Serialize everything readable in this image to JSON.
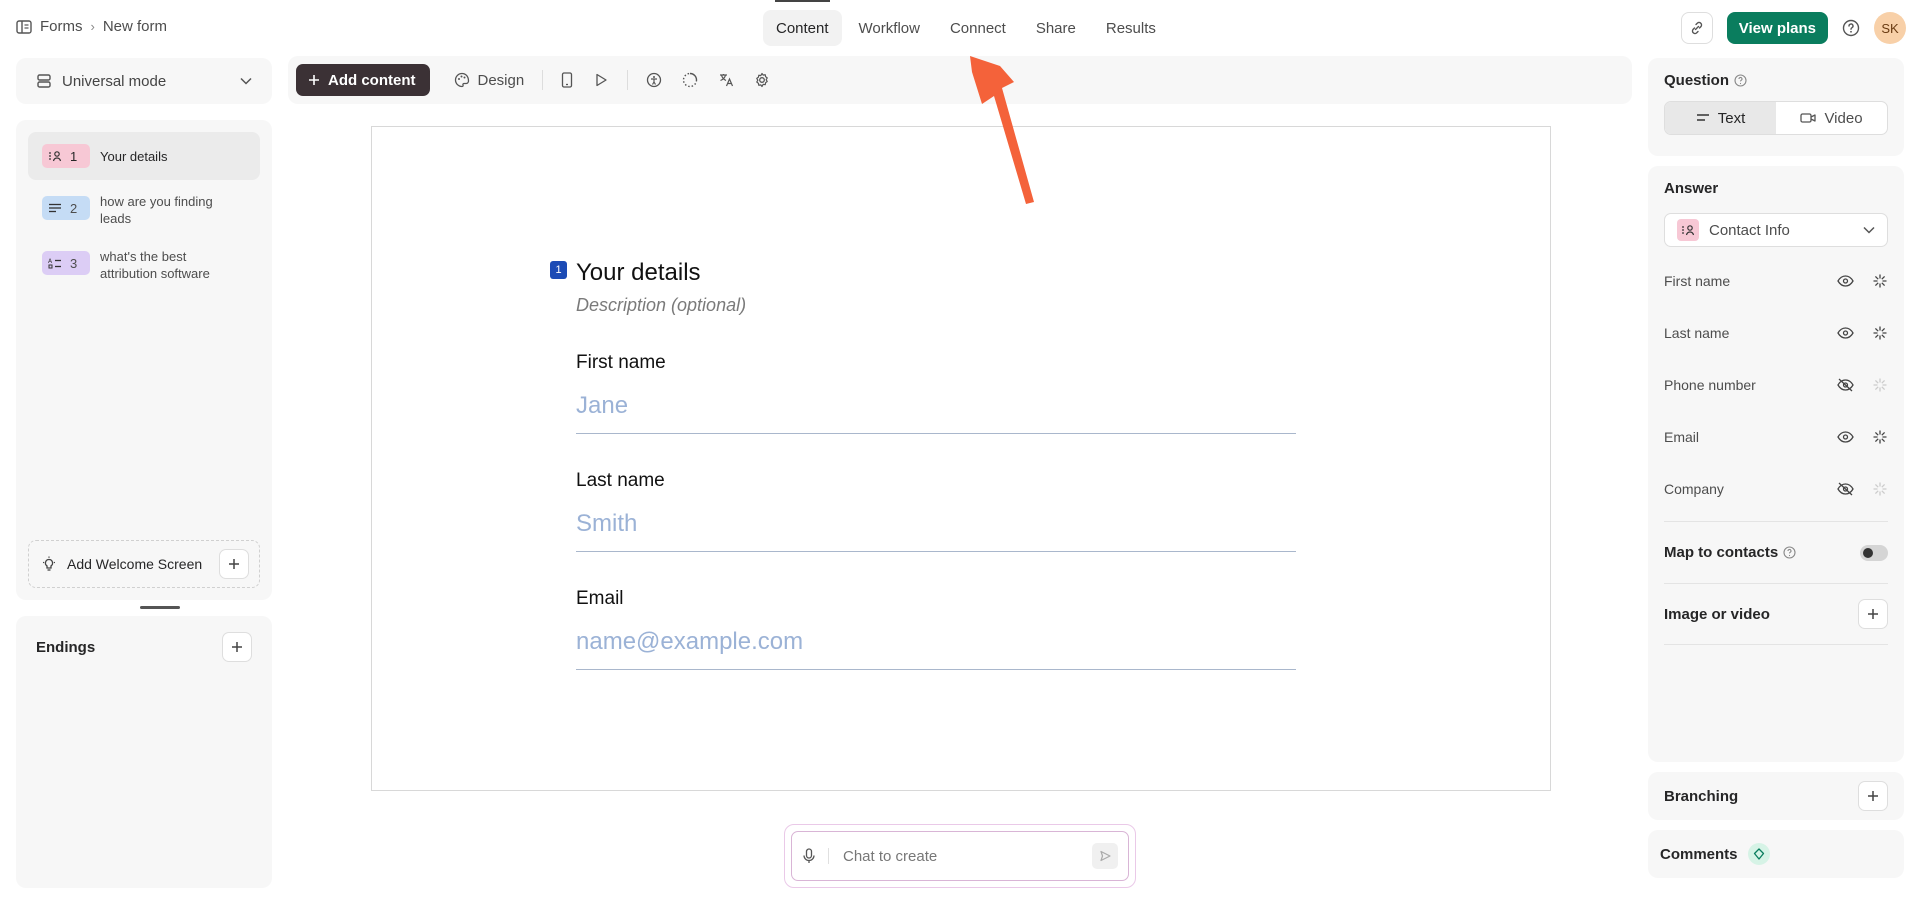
{
  "breadcrumb": {
    "root": "Forms",
    "current": "New form"
  },
  "nav_tabs": [
    "Content",
    "Workflow",
    "Connect",
    "Share",
    "Results"
  ],
  "header": {
    "view_plans": "View plans",
    "avatar_initials": "SK"
  },
  "left": {
    "mode_label": "Universal mode",
    "questions": [
      {
        "num": "1",
        "title": "Your details",
        "color": "#f7c8d5"
      },
      {
        "num": "2",
        "title": "how are you finding leads",
        "color": "#c5dcf5"
      },
      {
        "num": "3",
        "title": "what's the best attribution software",
        "color": "#dccdf5"
      }
    ],
    "welcome_label": "Add Welcome Screen",
    "endings_label": "Endings"
  },
  "toolbar": {
    "add_content": "Add content",
    "design": "Design"
  },
  "form": {
    "number": "1",
    "title": "Your details",
    "description": "Description (optional)",
    "fields": [
      {
        "label": "First name",
        "placeholder": "Jane"
      },
      {
        "label": "Last name",
        "placeholder": "Smith"
      },
      {
        "label": "Email",
        "placeholder": "name@example.com"
      }
    ]
  },
  "chat": {
    "placeholder": "Chat to create"
  },
  "right": {
    "question_title": "Question",
    "seg_text": "Text",
    "seg_video": "Video",
    "answer_title": "Answer",
    "answer_type": "Contact Info",
    "fields": [
      {
        "name": "First name",
        "visible": true,
        "required_active": true
      },
      {
        "name": "Last name",
        "visible": true,
        "required_active": true
      },
      {
        "name": "Phone number",
        "visible": false,
        "required_active": false
      },
      {
        "name": "Email",
        "visible": true,
        "required_active": true
      },
      {
        "name": "Company",
        "visible": false,
        "required_active": false
      }
    ],
    "map_contacts": "Map to contacts",
    "image_video": "Image or video",
    "branching": "Branching",
    "comments": "Comments"
  },
  "colors": {
    "accent": "#0a7d5e",
    "arrow": "#f4623a",
    "question_badge": "#1c4bb5"
  }
}
